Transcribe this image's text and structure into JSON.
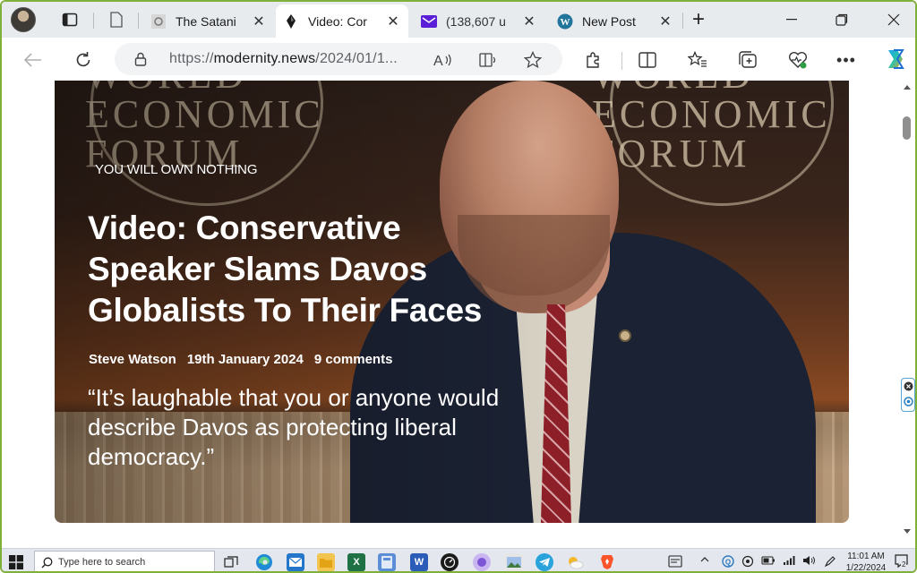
{
  "browser": {
    "tabs": [
      {
        "title": "The Satani",
        "active": false
      },
      {
        "title": "Video: Cor",
        "active": true
      },
      {
        "title": "(138,607 u",
        "active": false
      },
      {
        "title": "New Post",
        "active": false
      }
    ],
    "new_tab_symbol": "+",
    "close_symbol": "✕",
    "address": {
      "scheme": "https://",
      "host": "modernity.news",
      "path": "/2024/01/1..."
    }
  },
  "article": {
    "kicker": "YOU WILL OWN NOTHING",
    "headline": "Video: Conservative Speaker Slams Davos Globalists To Their Faces",
    "author": "Steve Watson",
    "date": "19th January 2024",
    "comments": "9 comments",
    "quote": "“It’s laughable that you or anyone would describe Davos as protecting liberal democracy.”",
    "background_text": {
      "line1": "WORLD",
      "line2": "ECONOMIC",
      "line3": "FORUM"
    }
  },
  "taskbar": {
    "search_placeholder": "Type here to search",
    "time": "11:01 AM",
    "date": "1/22/2024",
    "notification_count": "2"
  },
  "colors": {
    "accent_border": "#7fb03a",
    "tab_strip": "#e8ebee",
    "taskbar": "#e4e8ee"
  }
}
